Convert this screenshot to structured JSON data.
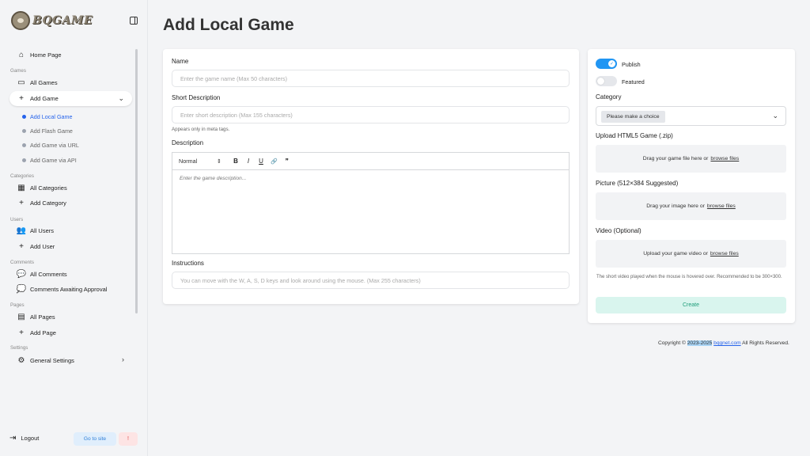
{
  "brand": {
    "name": "BQGAME"
  },
  "sidebar": {
    "home": "Home Page",
    "sections": {
      "games": "Games",
      "categories": "Categories",
      "users": "Users",
      "comments": "Comments",
      "pages": "Pages",
      "settings": "Settings"
    },
    "items": {
      "all_games": "All Games",
      "add_game": "Add Game",
      "all_categories": "All Categories",
      "add_category": "Add Category",
      "all_users": "All Users",
      "add_user": "Add User",
      "all_comments": "All Comments",
      "comments_awaiting": "Comments Awaiting Approval",
      "all_pages": "All Pages",
      "add_page": "Add Page",
      "general_settings": "General Settings"
    },
    "sub_items": {
      "add_local": "Add Local Game",
      "add_flash": "Add Flash Game",
      "add_url": "Add Game via URL",
      "add_api": "Add Game via API"
    },
    "logout": "Logout",
    "goto_site": "Go to site",
    "alert": "!"
  },
  "page": {
    "title": "Add Local Game"
  },
  "form": {
    "name_label": "Name",
    "name_placeholder": "Enter the game name (Max 50 characters)",
    "short_label": "Short Description",
    "short_placeholder": "Enter short description (Max 155 characters)",
    "short_hint": "Appears only in meta tags.",
    "desc_label": "Description",
    "toolbar": {
      "format": "Normal",
      "format_chev": "⇕",
      "bold": "B",
      "italic": "I",
      "underline": "U",
      "link": "🔗",
      "quote": "❞"
    },
    "desc_placeholder": "Enter the game description...",
    "instr_label": "Instructions",
    "instr_placeholder": "You can move with the W, A, S, D keys and look around using the mouse. (Max 255 characters)"
  },
  "settings_panel": {
    "publish": "Publish",
    "featured": "Featured",
    "category_label": "Category",
    "category_choice": "Please make a choice",
    "html5_label": "Upload HTML5 Game (.zip)",
    "html5_drop": "Drag your game file here or",
    "picture_label": "Picture (512×384 Suggested)",
    "picture_drop": "Drag your image here or",
    "video_label": "Video (Optional)",
    "video_drop": "Upload your game video or",
    "browse": "browse files",
    "video_hint": "The short video played when the mouse is hovered over. Recommended to be 300×300.",
    "create": "Create"
  },
  "footer": {
    "prefix": "Copyright ©",
    "years": "2023-2025",
    "site": "bqgnet.com",
    "suffix": "All Rights Reserved."
  }
}
